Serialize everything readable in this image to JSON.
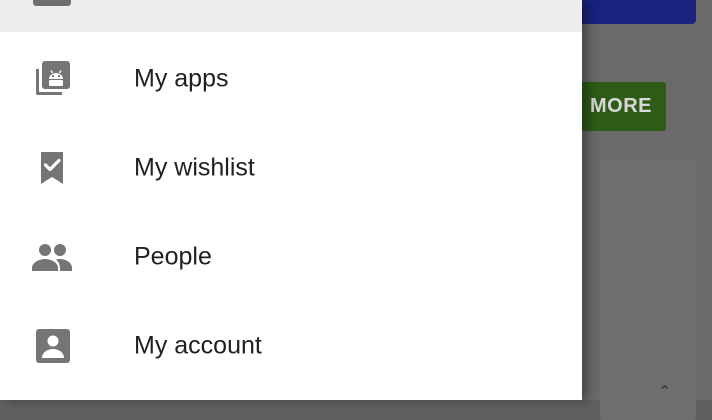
{
  "background_app": {
    "more_button_label": "MORE",
    "caret_glyph": "⌃"
  },
  "drawer": {
    "items": [
      {
        "label": "My apps",
        "icon": "my-apps-icon"
      },
      {
        "label": "My wishlist",
        "icon": "bookmark-check-icon"
      },
      {
        "label": "People",
        "icon": "people-icon"
      },
      {
        "label": "My account",
        "icon": "account-box-icon"
      }
    ]
  },
  "colors": {
    "icon": "#757575",
    "label": "#212121",
    "drawer_bg": "#ffffff",
    "selected_bg": "#eeeeee",
    "scrim": "#6a6a6a",
    "more_button": "#2e5c17",
    "top_bar": "#1a237e"
  }
}
